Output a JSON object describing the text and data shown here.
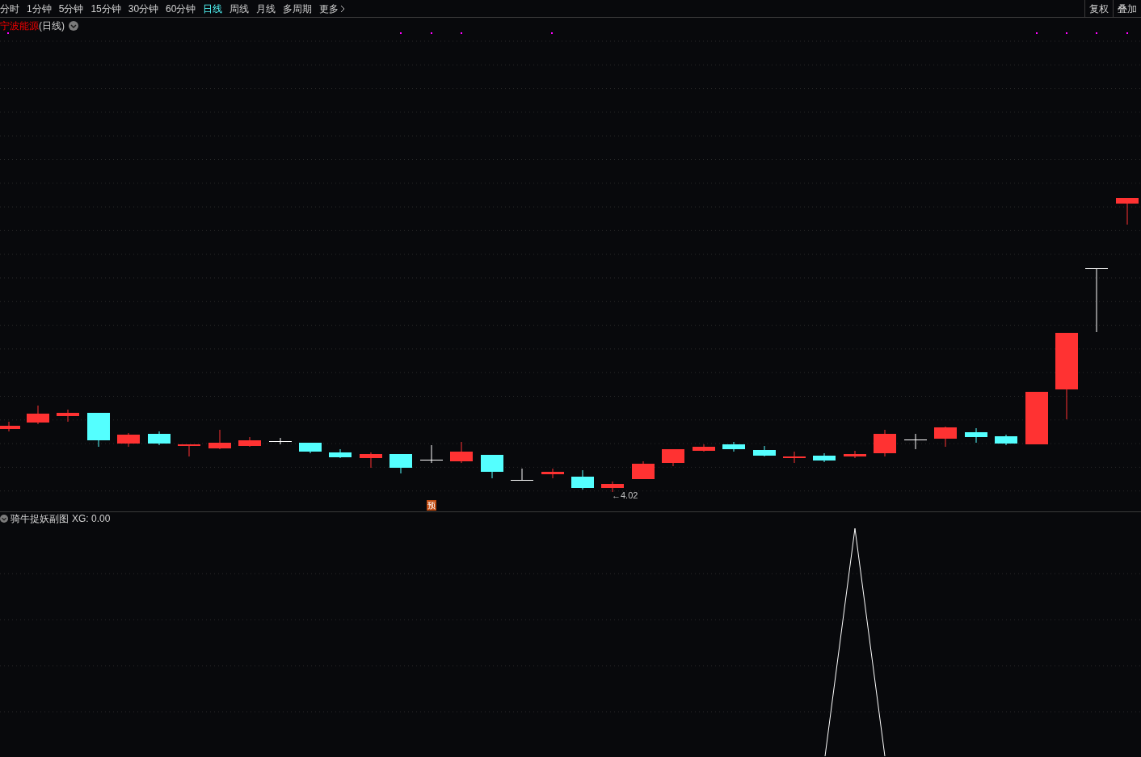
{
  "toolbar": {
    "periods": [
      {
        "label": "分时",
        "selected": false,
        "kind": "period"
      },
      {
        "label": "1分钟",
        "selected": false,
        "kind": "period"
      },
      {
        "label": "5分钟",
        "selected": false,
        "kind": "period"
      },
      {
        "label": "15分钟",
        "selected": false,
        "kind": "period"
      },
      {
        "label": "30分钟",
        "selected": false,
        "kind": "period"
      },
      {
        "label": "60分钟",
        "selected": false,
        "kind": "period"
      },
      {
        "label": "日线",
        "selected": true,
        "kind": "period"
      },
      {
        "label": "周线",
        "selected": false,
        "kind": "period"
      },
      {
        "label": "月线",
        "selected": false,
        "kind": "period"
      },
      {
        "label": "多周期",
        "selected": false,
        "kind": "period"
      },
      {
        "label": "更多",
        "selected": false,
        "kind": "menu"
      }
    ],
    "buttons": [
      "复权",
      "叠加"
    ]
  },
  "main_chart": {
    "stock_name": "宁波能源",
    "period_label": "(日线)",
    "low_label": "←4.02",
    "marker": "预"
  },
  "sub_chart": {
    "indicator_name": "骑牛捉妖副图",
    "reading": "XG: 0.00"
  }
}
